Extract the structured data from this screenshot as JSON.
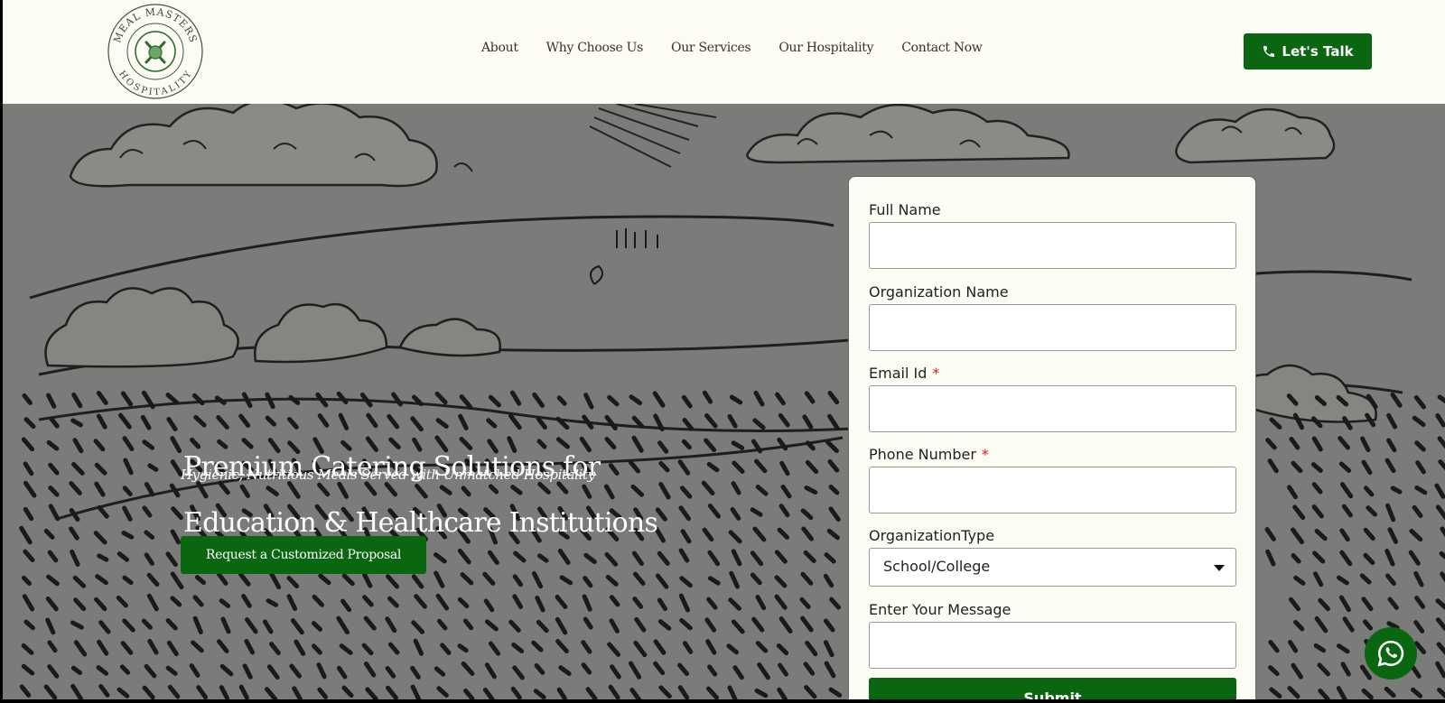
{
  "brand": {
    "logo_text_top": "MEAL MASTERS",
    "logo_text_bottom": "HOSPITALITY",
    "icon": "fork-knife-icon",
    "color": "#0a6610"
  },
  "nav": {
    "items": [
      "About",
      "Why Choose Us",
      "Our Services",
      "Our Hospitality",
      "Contact Now"
    ]
  },
  "header": {
    "talk_label": "Let's Talk",
    "talk_icon": "phone-icon"
  },
  "hero": {
    "title_line1": "Premium Catering Solutions for",
    "title_line2": "Education & Healthcare Institutions",
    "subtitle": "Hygienic, Nutritious Meals Served with Unmatched Hospitality",
    "cta_label": "Request a Customized Proposal"
  },
  "form": {
    "full_name_label": "Full Name",
    "org_name_label": "Organization Name",
    "email_label": "Email Id",
    "phone_label": "Phone Number",
    "required_mark": "*",
    "org_type_label": "OrganizationType",
    "org_type_value": "School/College",
    "message_label": "Enter Your Message",
    "submit_label": "Submit"
  },
  "floating": {
    "whatsapp_icon": "whatsapp-icon"
  }
}
